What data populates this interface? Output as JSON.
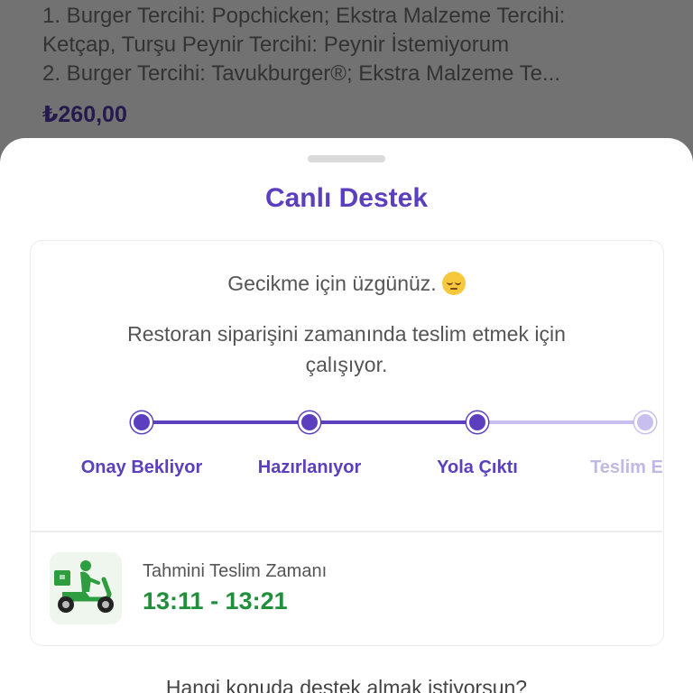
{
  "background_order": {
    "lines": [
      "1. Burger Tercihi: Popchicken; Ekstra Malzeme Tercihi:",
      "Ketçap, Turşu Peynir Tercihi: Peynir İstemiyorum",
      "2. Burger Tercihi: Tavukburger®; Ekstra Malzeme Te..."
    ],
    "price": "₺260,00"
  },
  "sheet": {
    "title": "Canlı Destek",
    "apology": "Gecikme için üzgünüz.",
    "apology_emoji": "pensive-face-icon",
    "message": "Restoran siparişini zamanında teslim etmek için çalışıyor.",
    "steps": [
      {
        "label": "Onay Bekliyor",
        "state": "done"
      },
      {
        "label": "Hazırlanıyor",
        "state": "done"
      },
      {
        "label": "Yola Çıktı",
        "state": "current"
      },
      {
        "label": "Teslim Edildi",
        "state": "pending"
      }
    ],
    "eta": {
      "icon": "delivery-scooter-icon",
      "label": "Tahmini Teslim Zamanı",
      "value": "13:11 - 13:21"
    },
    "question": "Hangi konuda destek almak istiyorsun?"
  },
  "colors": {
    "accent": "#5b3fbf",
    "accent_light": "#c9bfee",
    "eta_green": "#1f8f3a"
  }
}
